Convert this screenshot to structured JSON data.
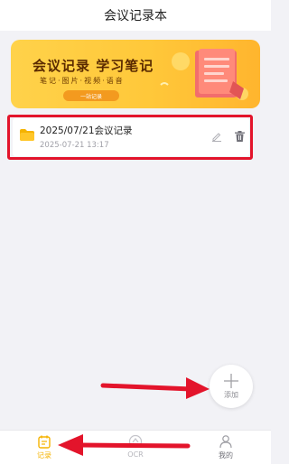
{
  "app": {
    "title": "会议记录本"
  },
  "banner": {
    "title": "会议记录 学习笔记",
    "subtitle": "笔记·图片·视频·语音",
    "tag": "一站记录"
  },
  "notes": [
    {
      "title": "2025/07/21会议记录",
      "date": "2025-07-21 13:17"
    }
  ],
  "fab": {
    "label": "添加"
  },
  "tabs": [
    {
      "label": "记录",
      "icon": "calendar-icon",
      "active": true
    },
    {
      "label": "OCR",
      "icon": "ocr-icon",
      "active": false
    },
    {
      "label": "我的",
      "icon": "person-icon",
      "active": false
    }
  ],
  "colors": {
    "accent": "#f5b300",
    "highlight": "#e3142b",
    "inactive": "#b5b5bb"
  }
}
